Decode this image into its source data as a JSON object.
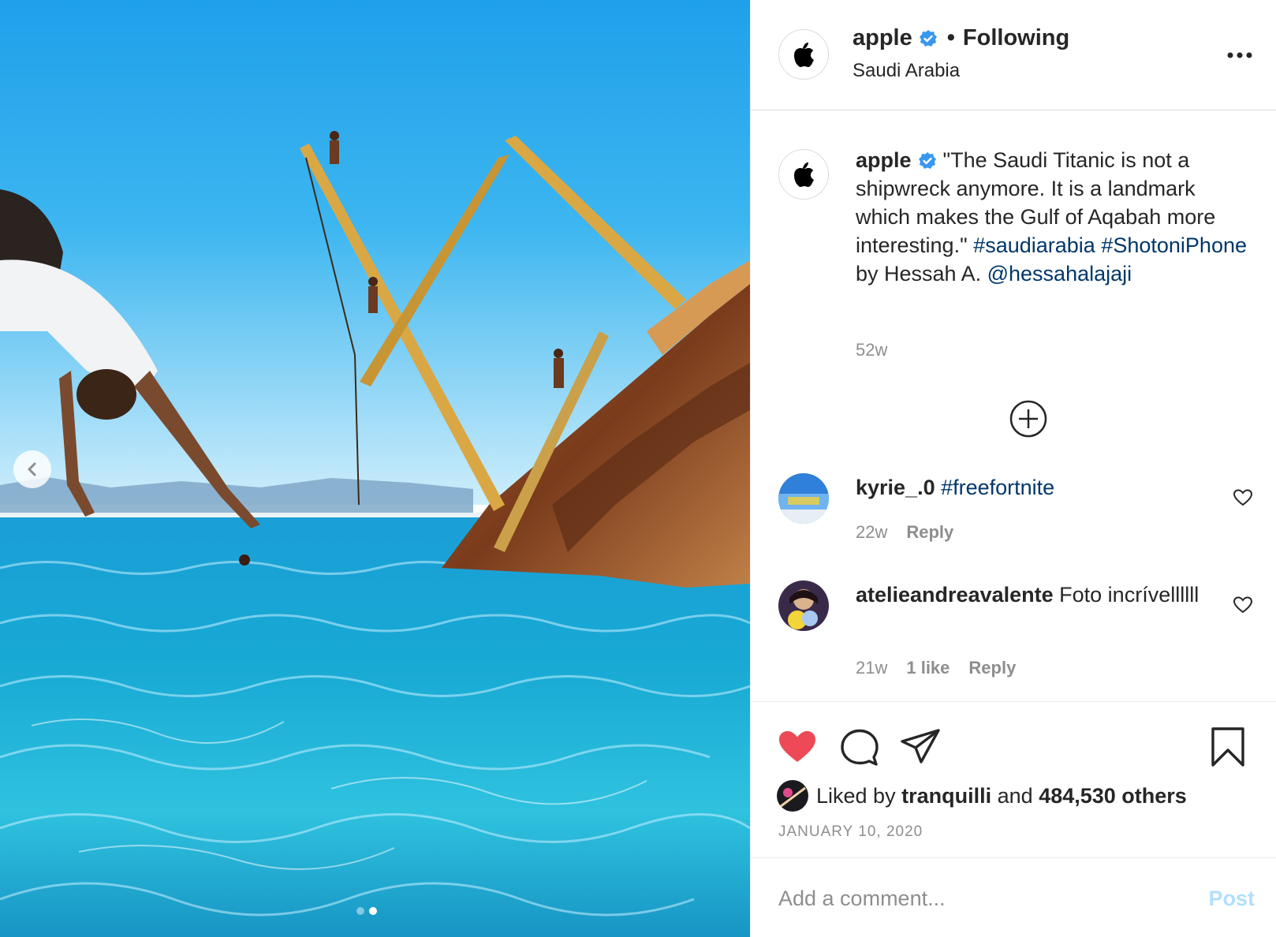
{
  "post": {
    "username": "apple",
    "verified": true,
    "follow_status": "Following",
    "location": "Saudi Arabia",
    "more_icon": "more-horizontal-icon"
  },
  "caption": {
    "username": "apple",
    "text_part1": "\"The Saudi Titanic is not a shipwreck anymore. It is a landmark which makes the Gulf of Aqabah more interesting.\"",
    "hashtag1": "#saudiarabia",
    "hashtag2": "#ShotoniPhone",
    "text_part2": "by Hessah A.",
    "mention": "@hessahalajaji",
    "time": "52w"
  },
  "load_more_icon": "plus-circle-icon",
  "comments": [
    {
      "username": "kyrie_.0",
      "text": "",
      "hashtag": "#freefortnite",
      "time": "22w",
      "likes": "",
      "reply": "Reply"
    },
    {
      "username": "atelieandreavalente",
      "text": "Foto incrívellllll",
      "hashtag": "",
      "time": "21w",
      "likes": "1 like",
      "reply": "Reply"
    }
  ],
  "actions": {
    "liked": true,
    "like_color": "#ed4956",
    "icons": [
      "heart-icon",
      "comment-icon",
      "share-icon",
      "bookmark-icon"
    ]
  },
  "likes": {
    "prefix": "Liked by",
    "user": "tranquilli",
    "conj": "and",
    "others": "484,530 others"
  },
  "date": "JANUARY 10, 2020",
  "add_comment": {
    "placeholder": "Add a comment...",
    "post_label": "Post"
  },
  "carousel": {
    "slides": 2,
    "active": 2
  }
}
